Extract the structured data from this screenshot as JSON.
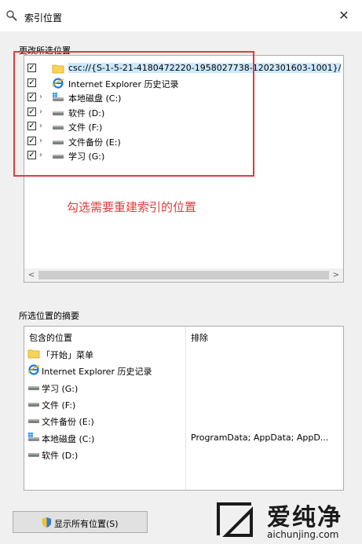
{
  "window": {
    "title": "索引位置",
    "close_glyph": "✕"
  },
  "change_section": {
    "label": "更改所选位置",
    "items": [
      {
        "label": "csc://{S-1-5-21-4180472220-1958027738-1202301603-1001}/",
        "checked": true,
        "expandable": false,
        "icon": "folder-icon",
        "selected": true
      },
      {
        "label": "Internet Explorer 历史记录",
        "checked": true,
        "expandable": false,
        "icon": "internet-explorer-icon"
      },
      {
        "label": "本地磁盘 (C:)",
        "checked": true,
        "expandable": true,
        "icon": "windows-drive-icon"
      },
      {
        "label": "软件 (D:)",
        "checked": true,
        "expandable": true,
        "icon": "drive-icon"
      },
      {
        "label": "文件 (F:)",
        "checked": true,
        "expandable": true,
        "icon": "drive-icon"
      },
      {
        "label": "文件备份 (E:)",
        "checked": true,
        "expandable": true,
        "icon": "drive-icon"
      },
      {
        "label": "学习 (G:)",
        "checked": true,
        "expandable": true,
        "icon": "drive-icon"
      }
    ],
    "scroll_left": "<",
    "scroll_right": ">"
  },
  "annotation": {
    "text": "勾选需要重建索引的位置",
    "color": "#e03c3c"
  },
  "summary_section": {
    "label": "所选位置的摘要",
    "col_included": "包含的位置",
    "col_excluded": "排除",
    "rows": [
      {
        "label": "「开始」菜单",
        "icon": "folder-icon",
        "exclude": ""
      },
      {
        "label": "Internet Explorer 历史记录",
        "icon": "internet-explorer-icon",
        "exclude": ""
      },
      {
        "label": "学习 (G:)",
        "icon": "drive-icon",
        "exclude": ""
      },
      {
        "label": "文件 (F:)",
        "icon": "drive-icon",
        "exclude": ""
      },
      {
        "label": "文件备份 (E:)",
        "icon": "drive-icon",
        "exclude": ""
      },
      {
        "label": "本地磁盘 (C:)",
        "icon": "windows-drive-icon",
        "exclude": "ProgramData; AppData; AppD..."
      },
      {
        "label": "软件 (D:)",
        "icon": "drive-icon",
        "exclude": ""
      }
    ]
  },
  "show_all_button": {
    "label": "显示所有位置(S)",
    "icon": "shield-icon"
  },
  "watermark": {
    "title": "爱纯净",
    "url": "aichunjing.com"
  },
  "colors": {
    "selection": "#cce8ff",
    "annotation": "#e03c3c"
  }
}
